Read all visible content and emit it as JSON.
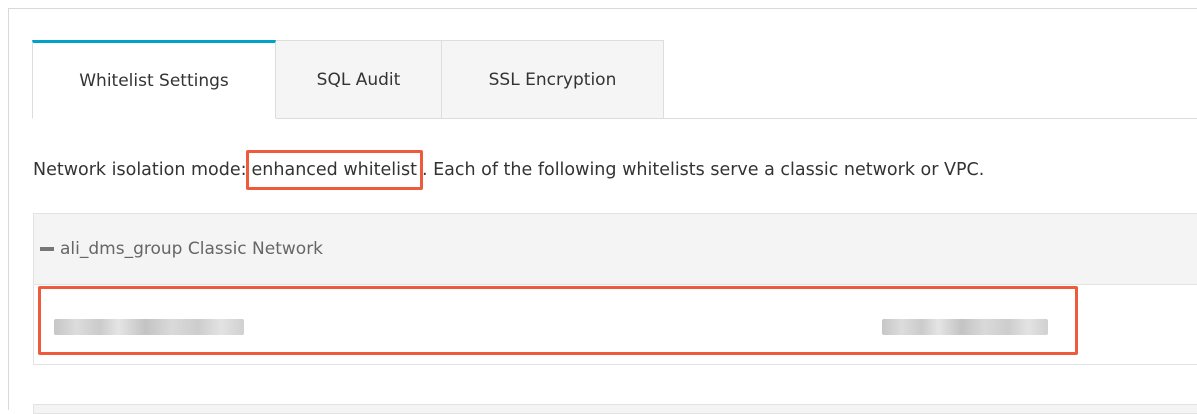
{
  "tabs": [
    {
      "label": "Whitelist Settings",
      "active": true
    },
    {
      "label": "SQL Audit",
      "active": false
    },
    {
      "label": "SSL Encryption",
      "active": false
    }
  ],
  "mode_line": {
    "prefix": "Network isolation mode:",
    "mode": "enhanced whitelist",
    "suffix": ". Each of the following whitelists serve a classic network or VPC."
  },
  "group": {
    "name": "ali_dms_group Classic Network",
    "collapse_icon": "minus-icon"
  },
  "colors": {
    "tab_accent": "#00a2ca",
    "highlight": "#ee5a3c",
    "panel_header_bg": "#f4f4f4"
  }
}
